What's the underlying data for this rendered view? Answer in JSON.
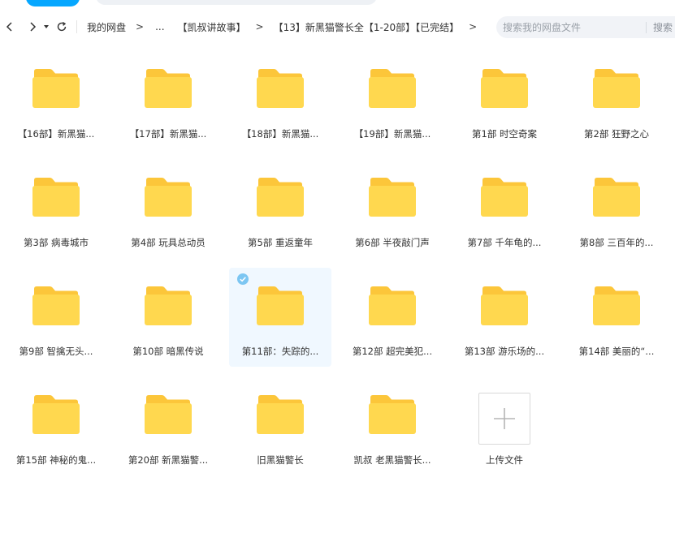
{
  "nav": {
    "breadcrumbs": [
      "我的网盘",
      "【凯叔讲故事】",
      "【13】新黑猫警长全【1-20部】【已完结】"
    ],
    "ellipsis": "...",
    "separator": ">"
  },
  "search": {
    "placeholder": "搜索我的网盘文件",
    "button_label": "搜索"
  },
  "colors": {
    "folder_body": "#ffd84f",
    "folder_back": "#fcc63a",
    "selected_bg": "#f0f8ff",
    "check": "#7cc6f2"
  },
  "items": [
    {
      "name": "【16部】新黑猫..."
    },
    {
      "name": "【17部】新黑猫..."
    },
    {
      "name": "【18部】新黑猫..."
    },
    {
      "name": "【19部】新黑猫..."
    },
    {
      "name": "第1部 时空奇案"
    },
    {
      "name": "第2部 狂野之心"
    },
    {
      "name": "第3部 病毒城市"
    },
    {
      "name": "第4部 玩具总动员"
    },
    {
      "name": "第5部 重返童年"
    },
    {
      "name": "第6部 半夜敲门声"
    },
    {
      "name": "第7部 千年龟的..."
    },
    {
      "name": "第8部 三百年的..."
    },
    {
      "name": "第9部 智擒无头..."
    },
    {
      "name": "第10部 暗黑传说"
    },
    {
      "name": "第11部：失踪的...",
      "selected": true
    },
    {
      "name": "第12部 超完美犯..."
    },
    {
      "name": "第13部 游乐场的..."
    },
    {
      "name": "第14部 美丽的“..."
    },
    {
      "name": "第15部 神秘的鬼..."
    },
    {
      "name": "第20部 新黑猫警..."
    },
    {
      "name": "旧黑猫警长"
    },
    {
      "name": "凯叔 老黑猫警长..."
    }
  ],
  "upload": {
    "label": "上传文件"
  }
}
